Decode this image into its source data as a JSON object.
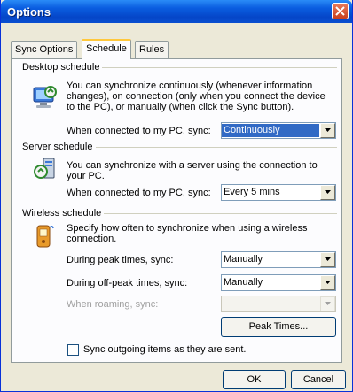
{
  "window": {
    "title": "Options"
  },
  "tabs": [
    {
      "label": "Sync Options"
    },
    {
      "label": "Schedule"
    },
    {
      "label": "Rules"
    }
  ],
  "desktop": {
    "heading": "Desktop schedule",
    "description": "You can synchronize continuously (whenever information changes), on connection (only when you connect the device to the PC), or manually (when click the Sync button).",
    "sync_label": "When connected to my PC, sync:",
    "sync_value": "Continuously"
  },
  "server": {
    "heading": "Server schedule",
    "description": "You can synchronize with a server using the connection to your PC.",
    "sync_label": "When connected to my PC, sync:",
    "sync_value": "Every 5 mins"
  },
  "wireless": {
    "heading": "Wireless schedule",
    "description": "Specify how often to synchronize when using a wireless connection.",
    "peak_label": "During peak times, sync:",
    "peak_value": "Manually",
    "offpeak_label": "During off-peak times, sync:",
    "offpeak_value": "Manually",
    "roaming_label": "When roaming, sync:",
    "roaming_value": "",
    "peak_times_button": "Peak Times..."
  },
  "sync_outgoing": {
    "label": "Sync outgoing items as they are sent.",
    "checked": false
  },
  "footer": {
    "ok": "OK",
    "cancel": "Cancel"
  },
  "icons": {
    "desktop": "desktop-sync-icon",
    "server": "server-sync-icon",
    "wireless": "wireless-device-icon",
    "close": "close-icon",
    "dropdown": "chevron-down-icon"
  },
  "colors": {
    "titlebar": "#0a5de0",
    "selection": "#316ac5",
    "tab_highlight": "#ffc83c",
    "dialog": "#ece9d8"
  }
}
